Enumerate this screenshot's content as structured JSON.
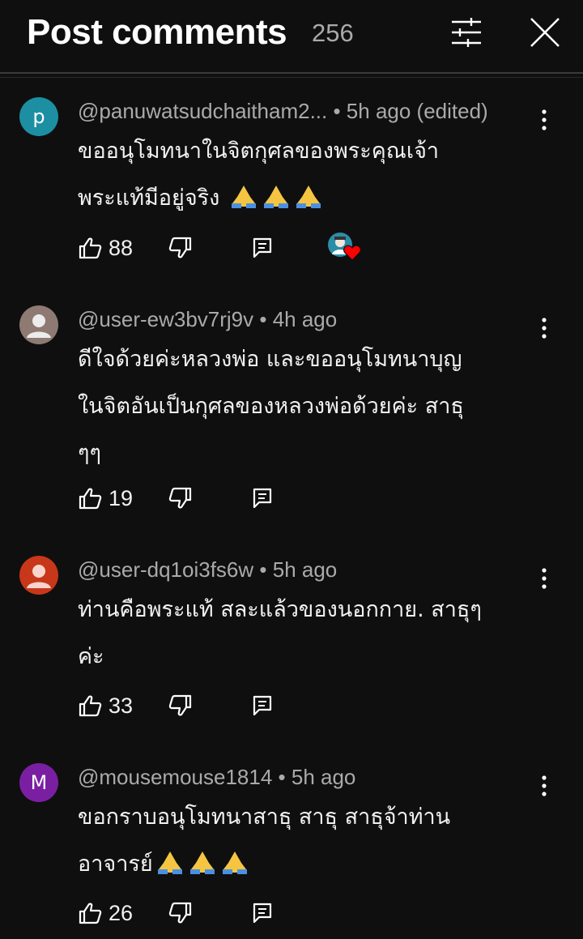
{
  "header": {
    "title": "Post comments",
    "count": "256",
    "filter_icon": "sliders-icon",
    "close_icon": "close-icon"
  },
  "colors": {
    "background": "#0f0f0f",
    "text_primary": "#f1f1f1",
    "text_secondary": "#aaaaaa",
    "heart": "#ff0000"
  },
  "comments": [
    {
      "author": "@panuwatsudchaitham2...",
      "meta_suffix": "• 5h ago (edited)",
      "avatar_letter": "p",
      "avatar_color": "#1c8fa3",
      "text_lines": [
        "ขออนุโมทนาในจิตกุศลของพระคุณเจ้า",
        "พระแท้มีอยู่จริง"
      ],
      "emoji_count": 3,
      "likes": "88",
      "creator_heart": true
    },
    {
      "author": "@user-ew3bv7rj9v",
      "meta_suffix": "• 4h ago",
      "avatar_letter": "",
      "avatar_color": "#8e7a72",
      "text_lines": [
        "ดีใจด้วยค่ะหลวงพ่อ  และขออนุโมทนาบุญ",
        "ในจิตอันเป็นกุศลของหลวงพ่อด้วยค่ะ สาธุ",
        "ๆๆ"
      ],
      "emoji_count": 0,
      "likes": "19",
      "creator_heart": false
    },
    {
      "author": "@user-dq1oi3fs6w",
      "meta_suffix": "• 5h ago",
      "avatar_letter": "",
      "avatar_color": "#c8371a",
      "text_lines": [
        "ท่านคือพระแท้ สละแล้วของนอกกาย. สาธุๆ",
        "ค่ะ"
      ],
      "emoji_count": 0,
      "likes": "33",
      "creator_heart": false
    },
    {
      "author": "@mousemouse1814",
      "meta_suffix": "• 5h ago",
      "avatar_letter": "M",
      "avatar_color": "#7b1fa2",
      "text_lines": [
        "ขอกราบอนุโมทนาสาธุ สาธุ สาธุจ้าท่าน",
        "อาจารย์"
      ],
      "emoji_count": 3,
      "likes": "26",
      "creator_heart": false
    }
  ]
}
